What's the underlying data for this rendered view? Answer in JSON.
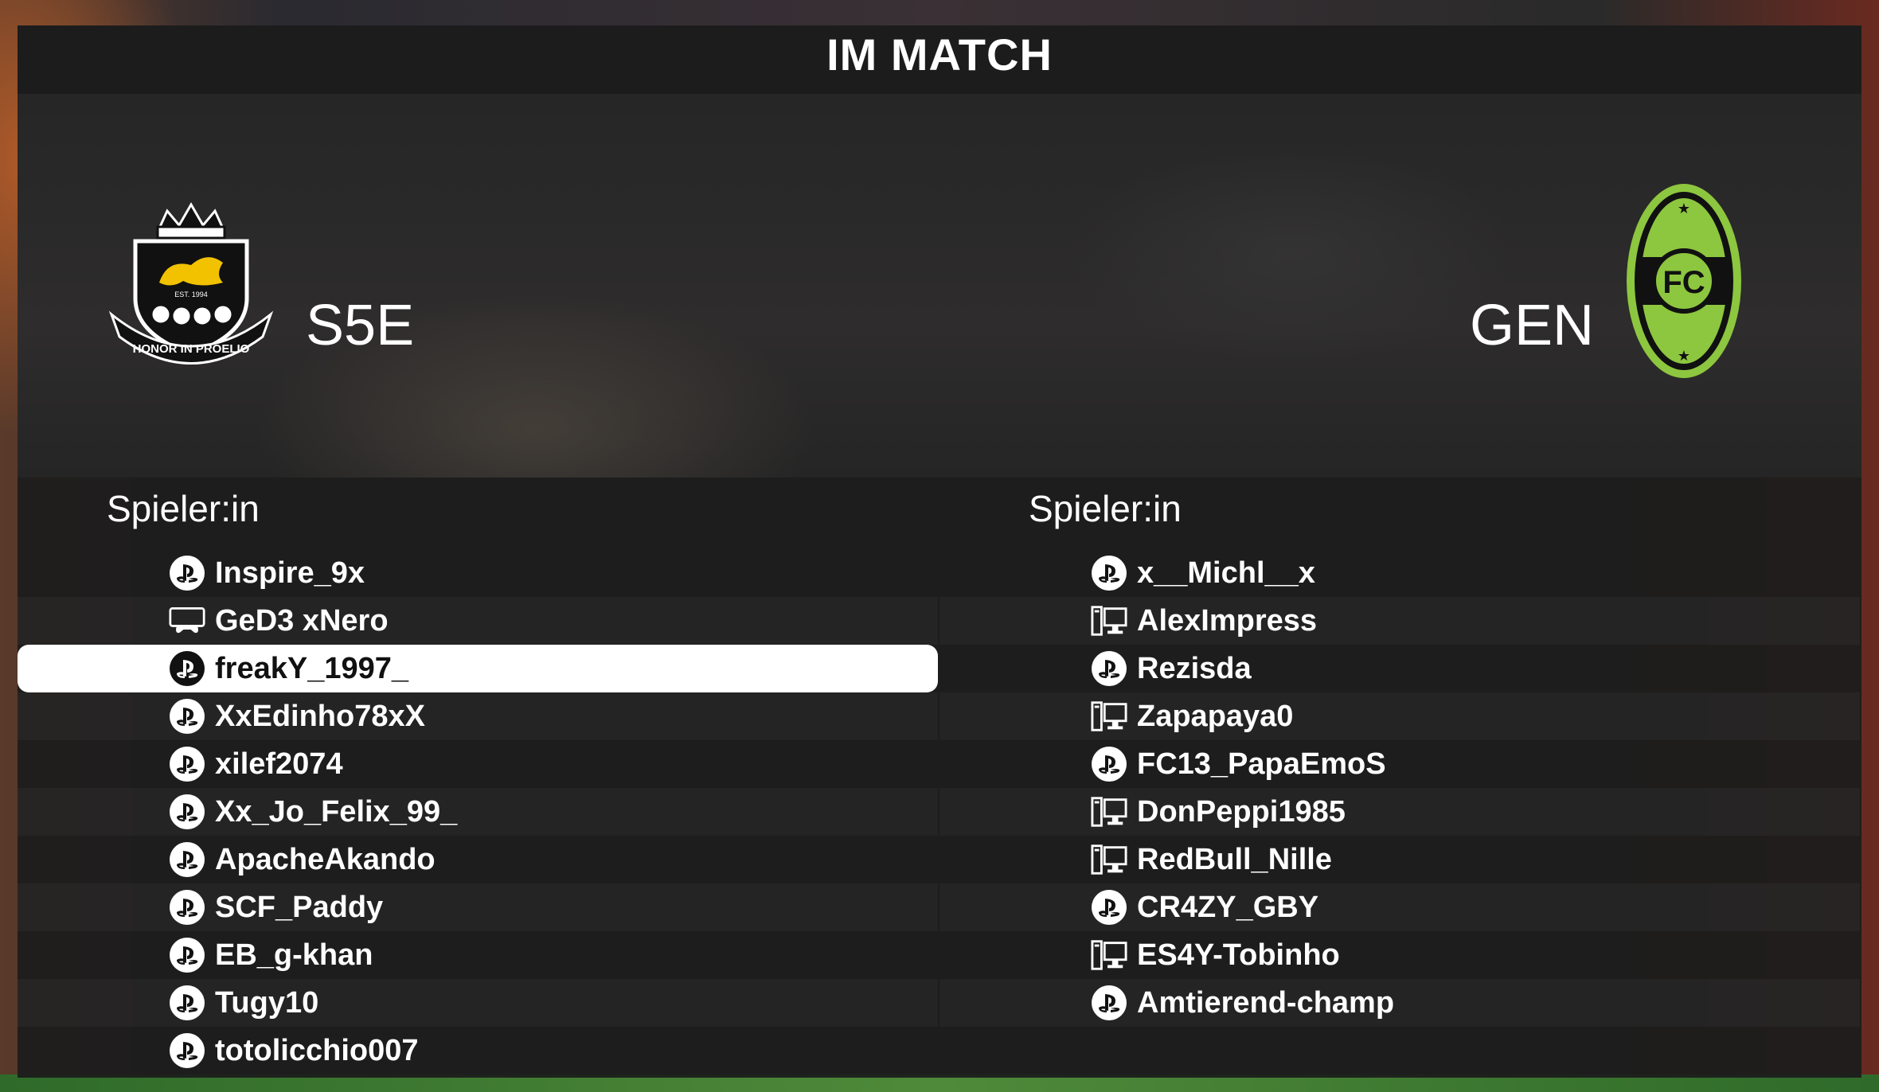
{
  "header": {
    "title": "IM MATCH"
  },
  "teams": {
    "home": {
      "abbr": "S5E",
      "crest_motto": "HONOR IN PROELIO",
      "crest_est": "EST. 1994"
    },
    "away": {
      "abbr": "GEN",
      "crest_letter": "FC"
    }
  },
  "columns": {
    "left_header": "Spieler:in",
    "right_header": "Spieler:in"
  },
  "home_players": [
    {
      "name": "Inspire_9x",
      "platform": "playstation-icon"
    },
    {
      "name": "GeD3 xNero",
      "platform": "console-icon"
    },
    {
      "name": "freakY_1997_",
      "platform": "playstation-icon",
      "selected": true
    },
    {
      "name": "XxEdinho78xX",
      "platform": "playstation-icon"
    },
    {
      "name": "xilef2074",
      "platform": "playstation-icon"
    },
    {
      "name": "Xx_Jo_Felix_99_",
      "platform": "playstation-icon"
    },
    {
      "name": "ApacheAkando",
      "platform": "playstation-icon"
    },
    {
      "name": "SCF_Paddy",
      "platform": "playstation-icon"
    },
    {
      "name": "EB_g-khan",
      "platform": "playstation-icon"
    },
    {
      "name": "Tugy10",
      "platform": "playstation-icon"
    },
    {
      "name": "totolicchio007",
      "platform": "playstation-icon"
    }
  ],
  "away_players": [
    {
      "name": "x__Michl__x",
      "platform": "playstation-icon"
    },
    {
      "name": "AlexImpress",
      "platform": "pc-icon"
    },
    {
      "name": "Rezisda",
      "platform": "playstation-icon"
    },
    {
      "name": "Zapapaya0",
      "platform": "pc-icon"
    },
    {
      "name": "FC13_PapaEmoS",
      "platform": "playstation-icon"
    },
    {
      "name": "DonPeppi1985",
      "platform": "pc-icon"
    },
    {
      "name": "RedBull_Nille",
      "platform": "pc-icon"
    },
    {
      "name": "CR4ZY_GBY",
      "platform": "playstation-icon"
    },
    {
      "name": "ES4Y-Tobinho",
      "platform": "pc-icon"
    },
    {
      "name": "Amtierend-champ",
      "platform": "playstation-icon"
    }
  ],
  "colors": {
    "panel": "#1c1c1c",
    "selected_row": "#ffffff",
    "away_crest": "#8dc63f"
  }
}
